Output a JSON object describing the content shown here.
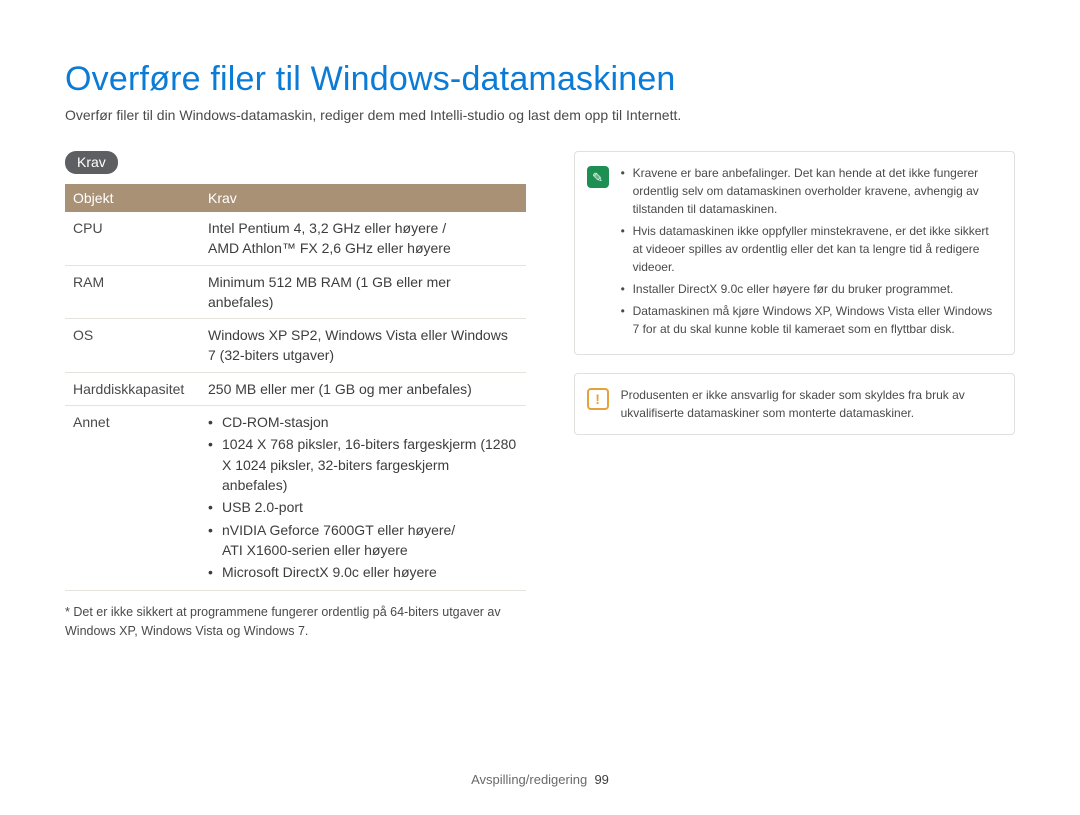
{
  "title": "Overføre filer til Windows-datamaskinen",
  "subtitle": "Overfør filer til din Windows-datamaskin, rediger dem med Intelli-studio og last dem opp til Internett.",
  "pill": "Krav",
  "table": {
    "h1": "Objekt",
    "h2": "Krav",
    "rows": {
      "cpu": {
        "label": "CPU",
        "value": "Intel Pentium 4, 3,2 GHz eller høyere /\nAMD Athlon™ FX 2,6 GHz eller høyere"
      },
      "ram": {
        "label": "RAM",
        "value": "Minimum 512 MB RAM (1 GB eller mer anbefales)"
      },
      "os": {
        "label": "OS",
        "value": "Windows XP SP2, Windows Vista eller Windows 7 (32-biters utgaver)"
      },
      "hdd": {
        "label": "Harddiskkapasitet",
        "value": "250 MB eller mer (1 GB og mer anbefales)"
      },
      "annet": {
        "label": "Annet"
      }
    },
    "annet_items": {
      "a": "CD-ROM-stasjon",
      "b": "1024 X 768 piksler, 16-biters fargeskjerm (1280 X 1024 piksler, 32-biters fargeskjerm anbefales)",
      "c": "USB 2.0-port",
      "d": "nVIDIA Geforce 7600GT eller høyere/\nATI X1600-serien eller høyere",
      "e": "Microsoft DirectX 9.0c eller høyere"
    }
  },
  "footnote": "* Det er ikke sikkert at programmene fungerer ordentlig på 64-biters utgaver av Windows XP, Windows Vista og Windows 7.",
  "info_notes": {
    "a": "Kravene er bare anbefalinger. Det kan hende at det ikke fungerer ordentlig selv om datamaskinen overholder kravene, avhengig av tilstanden til datamaskinen.",
    "b": "Hvis datamaskinen ikke oppfyller minstekravene, er det ikke sikkert at videoer spilles av ordentlig eller det kan ta lengre tid å redigere videoer.",
    "c": "Installer DirectX 9.0c eller høyere før du bruker programmet.",
    "d": "Datamaskinen må kjøre Windows XP, Windows Vista eller Windows 7 for at du skal kunne koble til kameraet som en flyttbar disk."
  },
  "warn_note": "Produsenten er ikke ansvarlig for skader som skyldes fra bruk av ukvalifiserte datamaskiner som monterte datamaskiner.",
  "footer": {
    "section": "Avspilling/redigering",
    "page": "99"
  }
}
